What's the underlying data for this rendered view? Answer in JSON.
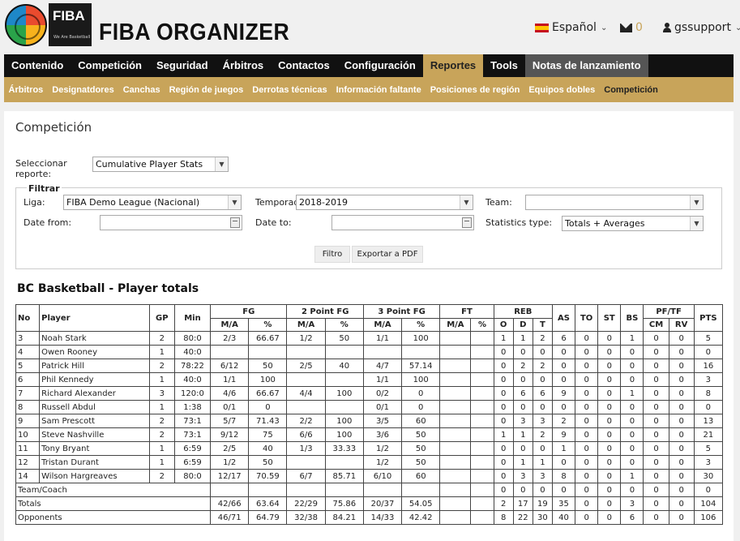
{
  "header": {
    "logo_text": "FIBA",
    "logo_sub": "We Are Basketball",
    "app_title": "FIBA ORGANIZER",
    "language": "Español",
    "mail_count": "0",
    "username": "gssupport"
  },
  "main_nav": [
    "Contenido",
    "Competición",
    "Seguridad",
    "Árbitros",
    "Contactos",
    "Configuración",
    "Reportes",
    "Tools",
    "Notas de lanzamiento"
  ],
  "sub_nav": [
    "Árbitros",
    "Designatdores",
    "Canchas",
    "Región de juegos",
    "Derrotas técnicas",
    "Información faltante",
    "Posiciones de región",
    "Equipos dobles",
    "Competición"
  ],
  "page": {
    "title": "Competición",
    "report_label": "Seleccionar reporte:",
    "report_value": "Cumulative Player Stats",
    "filter_legend": "Filtrar",
    "liga_label": "Liga:",
    "liga_value": "FIBA Demo League (Nacional)",
    "temporada_label": "Temporada:",
    "temporada_value": "2018-2019",
    "team_label": "Team:",
    "team_value": "",
    "date_from_label": "Date from:",
    "date_to_label": "Date to:",
    "stats_type_label": "Statistics type:",
    "stats_type_value": "Totals + Averages",
    "filter_button": "Filtro",
    "export_button": "Exportar a PDF",
    "section_title": "BC Basketball - Player totals"
  },
  "table": {
    "headers": {
      "no": "No",
      "player": "Player",
      "gp": "GP",
      "min": "Min",
      "fg": "FG",
      "fg2": "2 Point FG",
      "fg3": "3 Point FG",
      "ft": "FT",
      "reb": "REB",
      "as": "AS",
      "to": "TO",
      "st": "ST",
      "bs": "BS",
      "pftf": "PF/TF",
      "pts": "PTS",
      "ma": "M/A",
      "pct": "%",
      "o": "O",
      "d": "D",
      "t": "T",
      "cm": "CM",
      "rv": "RV"
    },
    "rows": [
      [
        "3",
        "Noah Stark",
        "2",
        "80:0",
        "2/3",
        "66.67",
        "1/2",
        "50",
        "1/1",
        "100",
        "",
        "",
        "1",
        "1",
        "2",
        "6",
        "0",
        "0",
        "1",
        "0",
        "0",
        "5"
      ],
      [
        "4",
        "Owen Rooney",
        "1",
        "40:0",
        "",
        "",
        "",
        "",
        "",
        "",
        "",
        "",
        "0",
        "0",
        "0",
        "0",
        "0",
        "0",
        "0",
        "0",
        "0",
        "0"
      ],
      [
        "5",
        "Patrick Hill",
        "2",
        "78:22",
        "6/12",
        "50",
        "2/5",
        "40",
        "4/7",
        "57.14",
        "",
        "",
        "0",
        "2",
        "2",
        "0",
        "0",
        "0",
        "0",
        "0",
        "0",
        "16"
      ],
      [
        "6",
        "Phil Kennedy",
        "1",
        "40:0",
        "1/1",
        "100",
        "",
        "",
        "1/1",
        "100",
        "",
        "",
        "0",
        "0",
        "0",
        "0",
        "0",
        "0",
        "0",
        "0",
        "0",
        "3"
      ],
      [
        "7",
        "Richard Alexander",
        "3",
        "120:0",
        "4/6",
        "66.67",
        "4/4",
        "100",
        "0/2",
        "0",
        "",
        "",
        "0",
        "6",
        "6",
        "9",
        "0",
        "0",
        "1",
        "0",
        "0",
        "8"
      ],
      [
        "8",
        "Russell Abdul",
        "1",
        "1:38",
        "0/1",
        "0",
        "",
        "",
        "0/1",
        "0",
        "",
        "",
        "0",
        "0",
        "0",
        "0",
        "0",
        "0",
        "0",
        "0",
        "0",
        "0"
      ],
      [
        "9",
        "Sam Prescott",
        "2",
        "73:1",
        "5/7",
        "71.43",
        "2/2",
        "100",
        "3/5",
        "60",
        "",
        "",
        "0",
        "3",
        "3",
        "2",
        "0",
        "0",
        "0",
        "0",
        "0",
        "13"
      ],
      [
        "10",
        "Steve Nashville",
        "2",
        "73:1",
        "9/12",
        "75",
        "6/6",
        "100",
        "3/6",
        "50",
        "",
        "",
        "1",
        "1",
        "2",
        "9",
        "0",
        "0",
        "0",
        "0",
        "0",
        "21"
      ],
      [
        "11",
        "Tony Bryant",
        "1",
        "6:59",
        "2/5",
        "40",
        "1/3",
        "33.33",
        "1/2",
        "50",
        "",
        "",
        "0",
        "0",
        "0",
        "1",
        "0",
        "0",
        "0",
        "0",
        "0",
        "5"
      ],
      [
        "12",
        "Tristan Durant",
        "1",
        "6:59",
        "1/2",
        "50",
        "",
        "",
        "1/2",
        "50",
        "",
        "",
        "0",
        "1",
        "1",
        "0",
        "0",
        "0",
        "0",
        "0",
        "0",
        "3"
      ],
      [
        "14",
        "Wilson Hargreaves",
        "2",
        "80:0",
        "12/17",
        "70.59",
        "6/7",
        "85.71",
        "6/10",
        "60",
        "",
        "",
        "0",
        "3",
        "3",
        "8",
        "0",
        "0",
        "1",
        "0",
        "0",
        "30"
      ]
    ],
    "team_coach": {
      "label": "Team/Coach",
      "vals": [
        "",
        "",
        "",
        "",
        "",
        "",
        "",
        "",
        "0",
        "0",
        "0",
        "0",
        "0",
        "0",
        "0",
        "0",
        "0",
        "0"
      ]
    },
    "totals": {
      "label": "Totals",
      "vals": [
        "42/66",
        "63.64",
        "22/29",
        "75.86",
        "20/37",
        "54.05",
        "",
        "",
        "2",
        "17",
        "19",
        "35",
        "0",
        "0",
        "3",
        "0",
        "0",
        "104"
      ]
    },
    "opponents": {
      "label": "Opponents",
      "vals": [
        "46/71",
        "64.79",
        "32/38",
        "84.21",
        "14/33",
        "42.42",
        "",
        "",
        "8",
        "22",
        "30",
        "40",
        "0",
        "0",
        "6",
        "0",
        "0",
        "106"
      ]
    }
  }
}
